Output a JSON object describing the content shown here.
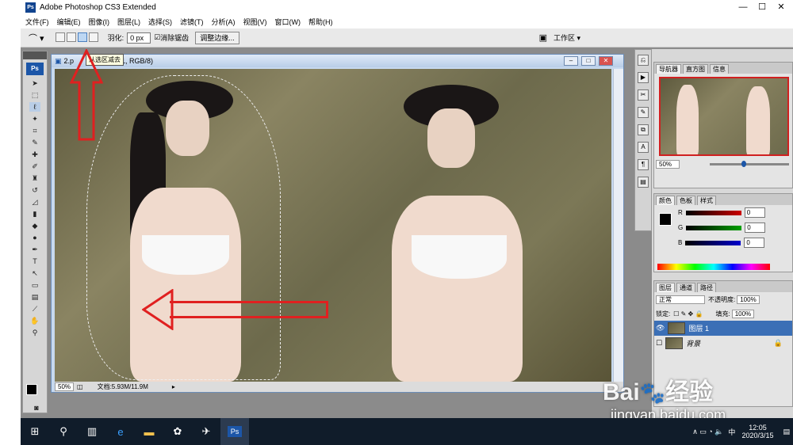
{
  "app": {
    "title": "Adobe Photoshop CS3 Extended",
    "window_controls": [
      "—",
      "☐",
      "✕"
    ]
  },
  "menu": [
    "文件(F)",
    "编辑(E)",
    "图像(I)",
    "图层(L)",
    "选择(S)",
    "滤镜(T)",
    "分析(A)",
    "视图(V)",
    "窗口(W)",
    "帮助(H)"
  ],
  "options": {
    "feather_label": "羽化:",
    "feather_value": "0 px",
    "antialias_label": "消除锯齿",
    "refine_edge_button": "调整边缘...",
    "workspace_label": "工作区 ▾"
  },
  "tooltip": "从选区减去",
  "document": {
    "title_left": "2.p",
    "title_right": "1, RGB/8)",
    "zoom": "50%",
    "doc_size": "文档:5.93M/11.9M"
  },
  "navigator": {
    "tabs": [
      "导航器",
      "直方图",
      "信息"
    ],
    "zoom": "50%"
  },
  "color_panel": {
    "tabs": [
      "颜色",
      "色板",
      "样式"
    ],
    "channels": [
      {
        "label": "R",
        "value": "0",
        "color": "#cc0000"
      },
      {
        "label": "G",
        "value": "0",
        "color": "#00a000"
      },
      {
        "label": "B",
        "value": "0",
        "color": "#0000cc"
      }
    ]
  },
  "layers_panel": {
    "tabs": [
      "图层",
      "通道",
      "路径"
    ],
    "blend_mode": "正常",
    "opacity_label": "不透明度:",
    "opacity_value": "100%",
    "lock_label": "锁定:",
    "fill_label": "填充:",
    "fill_value": "100%",
    "layers": [
      {
        "name": "图层 1",
        "selected": true
      },
      {
        "name": "背景",
        "selected": false
      }
    ]
  },
  "watermark": {
    "brand": "Bai",
    "brand2": "经验",
    "url": "jingyan.baidu.com"
  },
  "taskbar": {
    "ps_label": "Ps",
    "tray_ime": "中",
    "time": "12:05",
    "date": "2020/3/15"
  },
  "colors": {
    "arrow": "#e02020",
    "layer_selected": "#3b6fb6",
    "taskbar": "#101c2a"
  }
}
